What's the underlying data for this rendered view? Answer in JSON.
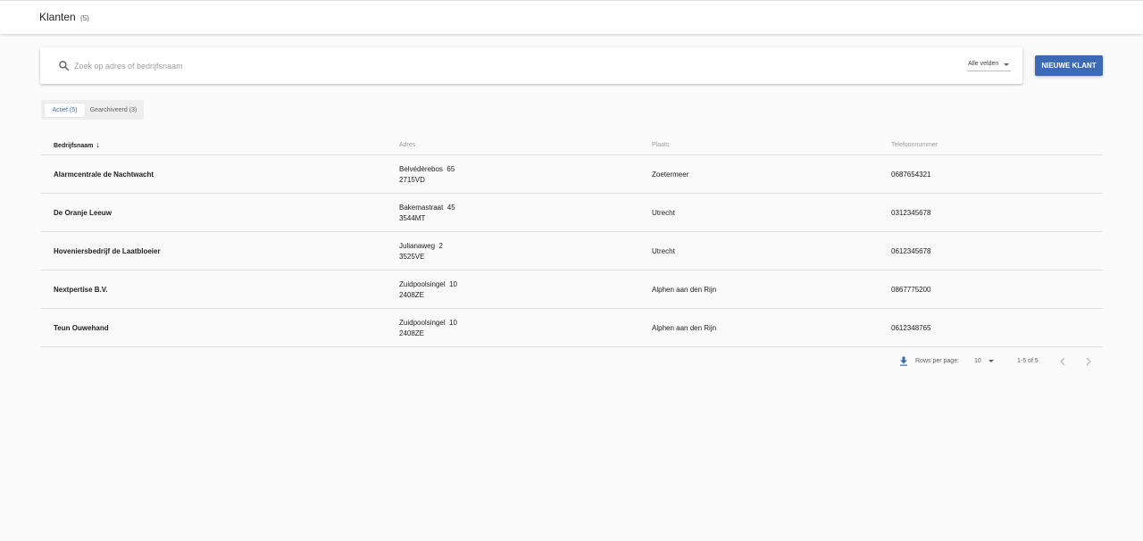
{
  "header": {
    "title": "Klanten",
    "count": "(5)"
  },
  "search": {
    "placeholder": "Zoek op adres of bedrijfsnaam",
    "value": "",
    "field_filter": "Alle velden"
  },
  "actions": {
    "new_button": "NIEUWE KLANT"
  },
  "tabs": [
    {
      "label": "Actief (5)",
      "active": true
    },
    {
      "label": "Gearchiveerd (3)",
      "active": false
    }
  ],
  "table": {
    "columns": [
      "Bedrijfsnaam",
      "Adres",
      "Plaats",
      "Telefoonnummer"
    ],
    "sorted_column": "Bedrijfsnaam",
    "sort_direction": "descending",
    "rows": [
      {
        "name": "Alarmcentrale de Nachtwacht",
        "street": "Belvédèrebos  65",
        "postcode": "2715VD",
        "city": "Zoetermeer",
        "phone": "0687654321"
      },
      {
        "name": "De Oranje Leeuw",
        "street": "Bakemastraat  45",
        "postcode": "3544MT",
        "city": "Utrecht",
        "phone": "0312345678"
      },
      {
        "name": "Hoveniersbedrijf de Laatbloeier",
        "street": "Julianaweg  2",
        "postcode": "3525VE",
        "city": "Utrecht",
        "phone": "0612345678"
      },
      {
        "name": "Nextpertise B.V.",
        "street": "Zuidpoolsingel  10",
        "postcode": "2408ZE",
        "city": "Alphen aan den Rijn",
        "phone": "0867775200"
      },
      {
        "name": "Teun Ouwehand",
        "street": "Zuidpoolsingel  10",
        "postcode": "2408ZE",
        "city": "Alphen aan den Rijn",
        "phone": "0612348765"
      }
    ]
  },
  "pagination": {
    "rows_per_page_label": "Rows per page:",
    "rows_per_page": "10",
    "range": "1-5 of 5"
  },
  "colors": {
    "accent": "#3d6bb3",
    "background": "#fafafa"
  }
}
